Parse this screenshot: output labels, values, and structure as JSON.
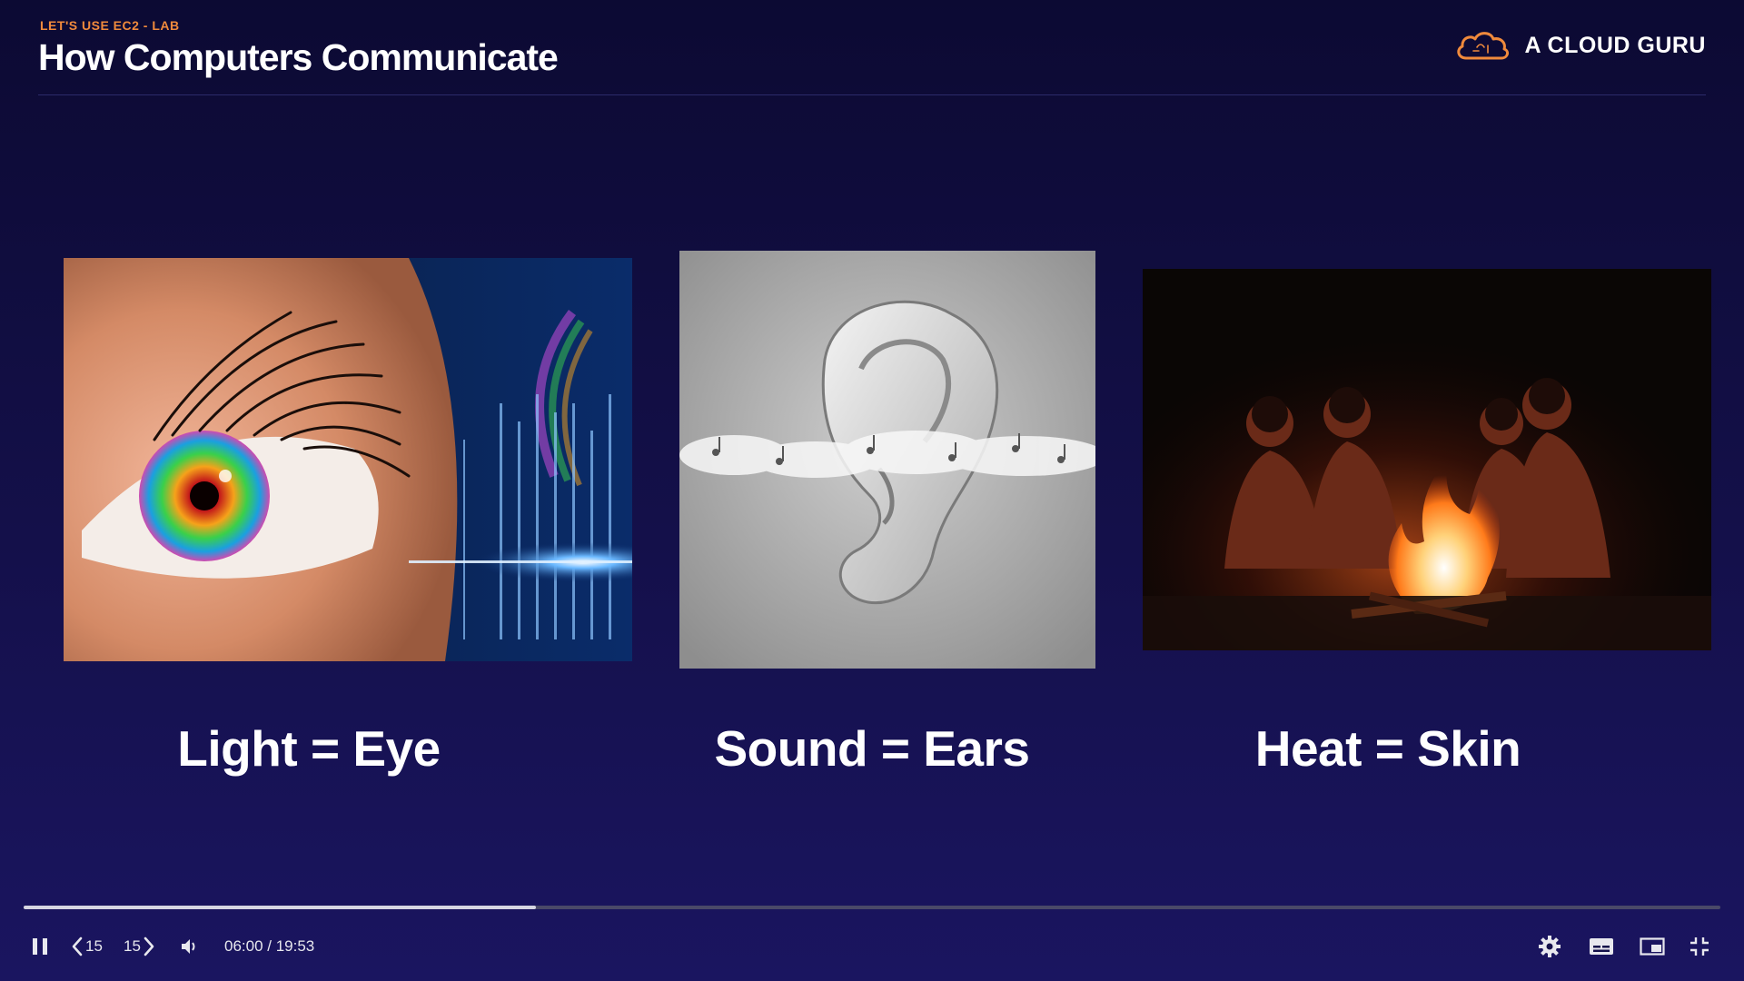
{
  "header": {
    "kicker": "LET'S USE EC2 - LAB",
    "title": "How Computers Communicate",
    "brand": "A CLOUD GURU",
    "brand_color": "#f08a3c"
  },
  "panels": [
    {
      "caption": "Light = Eye",
      "image": "eye-image"
    },
    {
      "caption": "Sound = Ears",
      "image": "ear-image"
    },
    {
      "caption": "Heat = Skin",
      "image": "campfire-image"
    }
  ],
  "player": {
    "current_time": "06:00",
    "duration": "19:53",
    "time_display": "06:00 / 19:53",
    "progress": 0.302,
    "skip_back_label": "15",
    "skip_forward_label": "15",
    "icons": {
      "pause": "pause-icon",
      "skip_back": "skip-back-icon",
      "skip_forward": "skip-forward-icon",
      "volume": "volume-icon",
      "settings": "gear-icon",
      "captions": "captions-icon",
      "pip": "picture-in-picture-icon",
      "exit_fullscreen": "exit-fullscreen-icon"
    }
  }
}
